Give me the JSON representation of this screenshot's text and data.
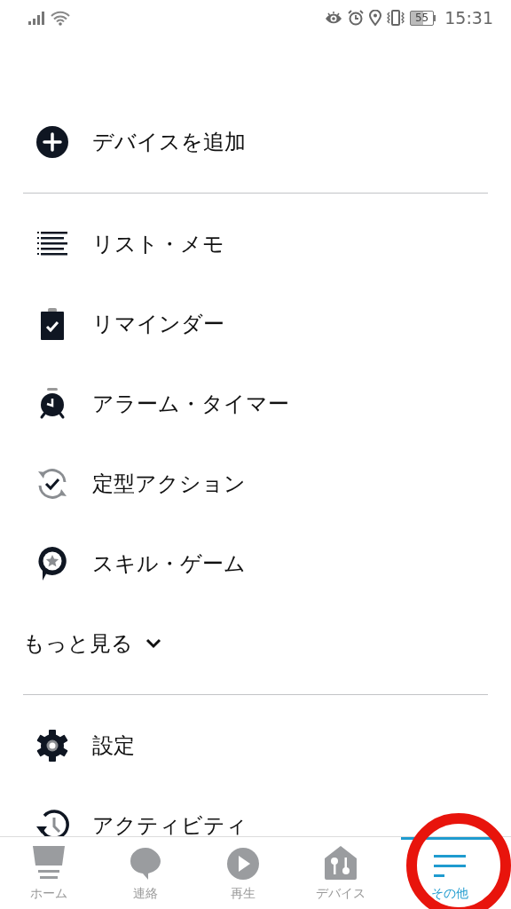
{
  "status_bar": {
    "battery": "55",
    "time": "15:31"
  },
  "sections": [
    {
      "items": [
        {
          "kind": "add",
          "label": "デバイスを追加"
        }
      ]
    },
    {
      "items": [
        {
          "kind": "list",
          "label": "リスト・メモ"
        },
        {
          "kind": "reminder",
          "label": "リマインダー"
        },
        {
          "kind": "alarm",
          "label": "アラーム・タイマー"
        },
        {
          "kind": "routine",
          "label": "定型アクション"
        },
        {
          "kind": "skill",
          "label": "スキル・ゲーム"
        }
      ],
      "more": {
        "label": "もっと見る",
        "expanded": false
      }
    },
    {
      "items": [
        {
          "kind": "settings",
          "label": "設定"
        },
        {
          "kind": "activity",
          "label": "アクティビティ"
        }
      ]
    }
  ],
  "tabs": [
    {
      "kind": "home",
      "label": "ホーム",
      "selected": false
    },
    {
      "kind": "chat",
      "label": "連絡",
      "selected": false
    },
    {
      "kind": "play",
      "label": "再生",
      "selected": false
    },
    {
      "kind": "devices",
      "label": "デバイス",
      "selected": false
    },
    {
      "kind": "more",
      "label": "その他",
      "selected": true
    }
  ]
}
